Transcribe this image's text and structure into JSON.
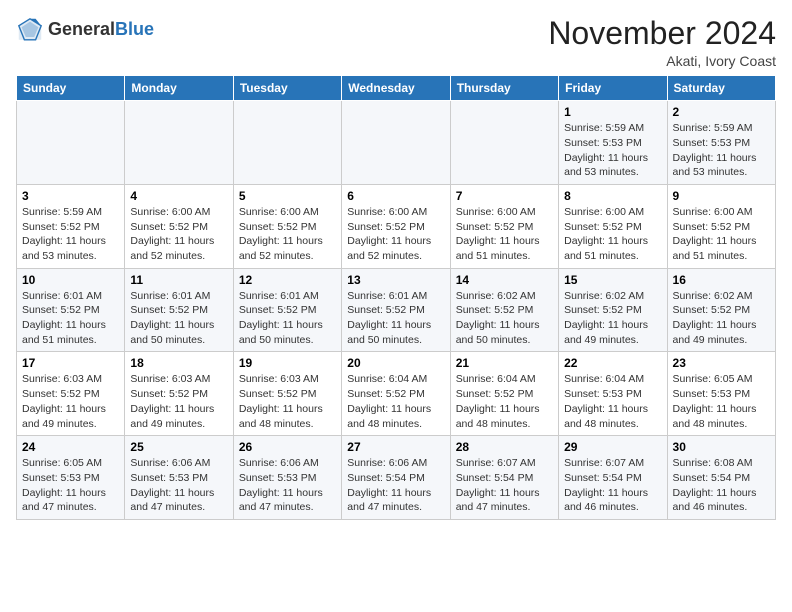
{
  "header": {
    "logo_general": "General",
    "logo_blue": "Blue",
    "month_title": "November 2024",
    "location": "Akati, Ivory Coast"
  },
  "days_of_week": [
    "Sunday",
    "Monday",
    "Tuesday",
    "Wednesday",
    "Thursday",
    "Friday",
    "Saturday"
  ],
  "weeks": [
    [
      {
        "day": "",
        "detail": ""
      },
      {
        "day": "",
        "detail": ""
      },
      {
        "day": "",
        "detail": ""
      },
      {
        "day": "",
        "detail": ""
      },
      {
        "day": "",
        "detail": ""
      },
      {
        "day": "1",
        "detail": "Sunrise: 5:59 AM\nSunset: 5:53 PM\nDaylight: 11 hours\nand 53 minutes."
      },
      {
        "day": "2",
        "detail": "Sunrise: 5:59 AM\nSunset: 5:53 PM\nDaylight: 11 hours\nand 53 minutes."
      }
    ],
    [
      {
        "day": "3",
        "detail": "Sunrise: 5:59 AM\nSunset: 5:52 PM\nDaylight: 11 hours\nand 53 minutes."
      },
      {
        "day": "4",
        "detail": "Sunrise: 6:00 AM\nSunset: 5:52 PM\nDaylight: 11 hours\nand 52 minutes."
      },
      {
        "day": "5",
        "detail": "Sunrise: 6:00 AM\nSunset: 5:52 PM\nDaylight: 11 hours\nand 52 minutes."
      },
      {
        "day": "6",
        "detail": "Sunrise: 6:00 AM\nSunset: 5:52 PM\nDaylight: 11 hours\nand 52 minutes."
      },
      {
        "day": "7",
        "detail": "Sunrise: 6:00 AM\nSunset: 5:52 PM\nDaylight: 11 hours\nand 51 minutes."
      },
      {
        "day": "8",
        "detail": "Sunrise: 6:00 AM\nSunset: 5:52 PM\nDaylight: 11 hours\nand 51 minutes."
      },
      {
        "day": "9",
        "detail": "Sunrise: 6:00 AM\nSunset: 5:52 PM\nDaylight: 11 hours\nand 51 minutes."
      }
    ],
    [
      {
        "day": "10",
        "detail": "Sunrise: 6:01 AM\nSunset: 5:52 PM\nDaylight: 11 hours\nand 51 minutes."
      },
      {
        "day": "11",
        "detail": "Sunrise: 6:01 AM\nSunset: 5:52 PM\nDaylight: 11 hours\nand 50 minutes."
      },
      {
        "day": "12",
        "detail": "Sunrise: 6:01 AM\nSunset: 5:52 PM\nDaylight: 11 hours\nand 50 minutes."
      },
      {
        "day": "13",
        "detail": "Sunrise: 6:01 AM\nSunset: 5:52 PM\nDaylight: 11 hours\nand 50 minutes."
      },
      {
        "day": "14",
        "detail": "Sunrise: 6:02 AM\nSunset: 5:52 PM\nDaylight: 11 hours\nand 50 minutes."
      },
      {
        "day": "15",
        "detail": "Sunrise: 6:02 AM\nSunset: 5:52 PM\nDaylight: 11 hours\nand 49 minutes."
      },
      {
        "day": "16",
        "detail": "Sunrise: 6:02 AM\nSunset: 5:52 PM\nDaylight: 11 hours\nand 49 minutes."
      }
    ],
    [
      {
        "day": "17",
        "detail": "Sunrise: 6:03 AM\nSunset: 5:52 PM\nDaylight: 11 hours\nand 49 minutes."
      },
      {
        "day": "18",
        "detail": "Sunrise: 6:03 AM\nSunset: 5:52 PM\nDaylight: 11 hours\nand 49 minutes."
      },
      {
        "day": "19",
        "detail": "Sunrise: 6:03 AM\nSunset: 5:52 PM\nDaylight: 11 hours\nand 48 minutes."
      },
      {
        "day": "20",
        "detail": "Sunrise: 6:04 AM\nSunset: 5:52 PM\nDaylight: 11 hours\nand 48 minutes."
      },
      {
        "day": "21",
        "detail": "Sunrise: 6:04 AM\nSunset: 5:52 PM\nDaylight: 11 hours\nand 48 minutes."
      },
      {
        "day": "22",
        "detail": "Sunrise: 6:04 AM\nSunset: 5:53 PM\nDaylight: 11 hours\nand 48 minutes."
      },
      {
        "day": "23",
        "detail": "Sunrise: 6:05 AM\nSunset: 5:53 PM\nDaylight: 11 hours\nand 48 minutes."
      }
    ],
    [
      {
        "day": "24",
        "detail": "Sunrise: 6:05 AM\nSunset: 5:53 PM\nDaylight: 11 hours\nand 47 minutes."
      },
      {
        "day": "25",
        "detail": "Sunrise: 6:06 AM\nSunset: 5:53 PM\nDaylight: 11 hours\nand 47 minutes."
      },
      {
        "day": "26",
        "detail": "Sunrise: 6:06 AM\nSunset: 5:53 PM\nDaylight: 11 hours\nand 47 minutes."
      },
      {
        "day": "27",
        "detail": "Sunrise: 6:06 AM\nSunset: 5:54 PM\nDaylight: 11 hours\nand 47 minutes."
      },
      {
        "day": "28",
        "detail": "Sunrise: 6:07 AM\nSunset: 5:54 PM\nDaylight: 11 hours\nand 47 minutes."
      },
      {
        "day": "29",
        "detail": "Sunrise: 6:07 AM\nSunset: 5:54 PM\nDaylight: 11 hours\nand 46 minutes."
      },
      {
        "day": "30",
        "detail": "Sunrise: 6:08 AM\nSunset: 5:54 PM\nDaylight: 11 hours\nand 46 minutes."
      }
    ]
  ]
}
